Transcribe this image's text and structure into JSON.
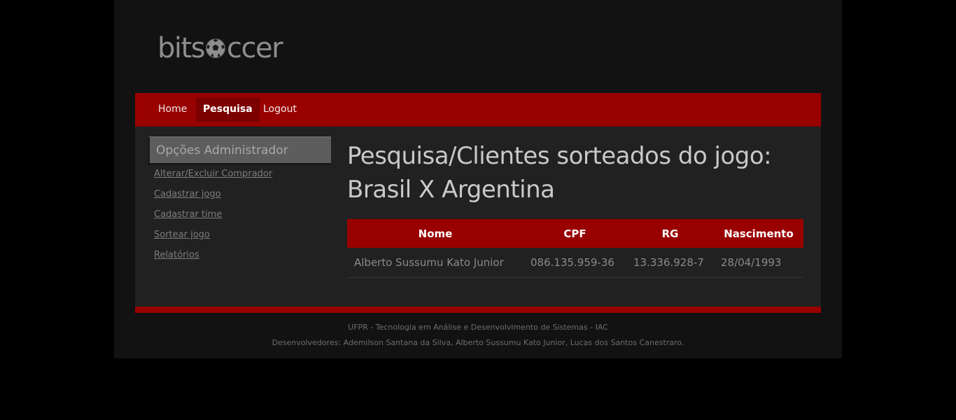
{
  "logo": {
    "text_before": "bits",
    "text_after": "ccer"
  },
  "nav": {
    "items": [
      {
        "label": "Home",
        "active": false
      },
      {
        "label": "Pesquisa",
        "active": true
      },
      {
        "label": "Logout",
        "active": false
      }
    ]
  },
  "sidebar": {
    "heading": "Opções Administrador",
    "links": [
      "Alterar/Excluir Comprador",
      "Cadastrar jogo",
      "Cadastrar time",
      "Sortear jogo",
      "Relatórios"
    ]
  },
  "main": {
    "title_line1": "Pesquisa/Clientes sorteados do jogo:",
    "title_line2": "Brasil X Argentina",
    "table": {
      "headers": [
        "Nome",
        "CPF",
        "RG",
        "Nascimento"
      ],
      "rows": [
        [
          "Alberto Sussumu Kato Junior",
          "086.135.959-36",
          "13.336.928-7",
          "28/04/1993"
        ]
      ]
    }
  },
  "footer": {
    "line1": "UFPR - Tecnologia em Análise e Desenvolvimento de Sistemas - IAC",
    "line2": "Desenvolvedores: Ademilson Santana da Silva, Alberto Sussumu Kato Junior, Lucas dos Santos Canestraro."
  },
  "colors": {
    "accent": "#990000",
    "nav_active": "#7c0000",
    "page_bg": "#000000",
    "wrapper_bg": "#121212",
    "content_bg": "#212121"
  }
}
